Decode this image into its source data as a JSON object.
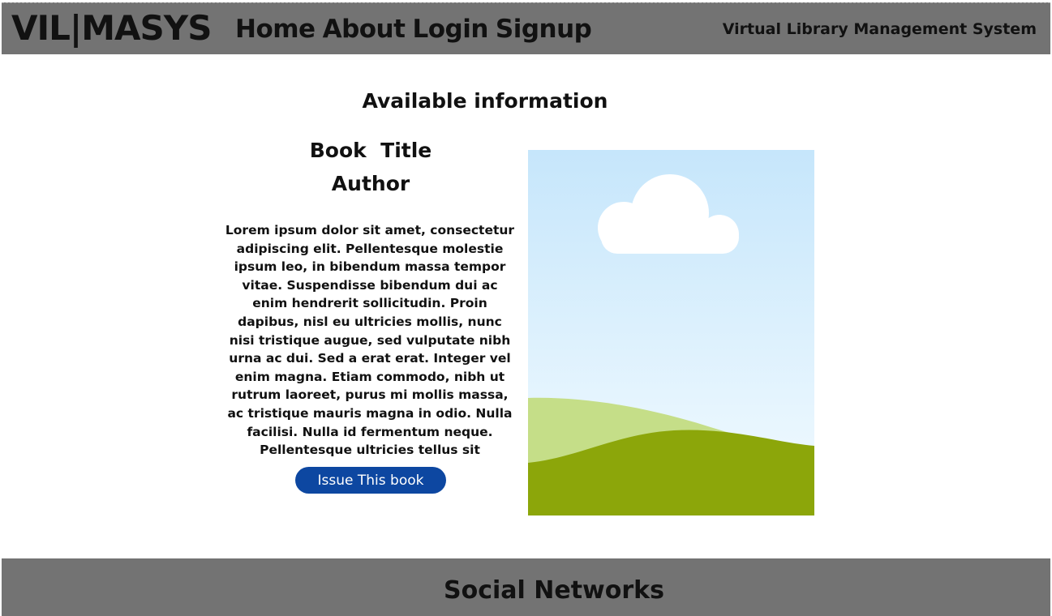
{
  "header": {
    "logo": "VIL|MASYS",
    "nav": [
      {
        "label": "Home"
      },
      {
        "label": "About"
      },
      {
        "label": "Login"
      },
      {
        "label": "Signup"
      }
    ],
    "tagline": "Virtual Library Management System"
  },
  "main": {
    "section_title": "Available information",
    "book": {
      "title": "Book  Title",
      "author": "Author",
      "description": "Lorem ipsum dolor sit amet, consectetur adipiscing elit. Pellentesque molestie ipsum leo, in bibendum massa tempor vitae. Suspendisse bibendum dui ac enim hendrerit sollicitudin. Proin dapibus, nisl eu ultricies mollis, nunc nisi tristique augue, sed vulputate nibh urna ac dui. Sed a erat erat. Integer vel enim magna. Etiam commodo, nibh ut rutrum laoreet, purus mi mollis massa, ac tristique mauris magna in odio. Nulla facilisi. Nulla id fermentum neque. Pellentesque ultricies tellus sit",
      "issue_button_label": "Issue This book",
      "cover_icon": "image-placeholder-icon"
    }
  },
  "footer": {
    "title": "Social Networks"
  },
  "colors": {
    "bar_background": "#737373",
    "button": "#0d47a1",
    "sky_top": "#c6e6fb",
    "hill_light": "#c5de88",
    "hill_dark": "#8ca60a"
  }
}
